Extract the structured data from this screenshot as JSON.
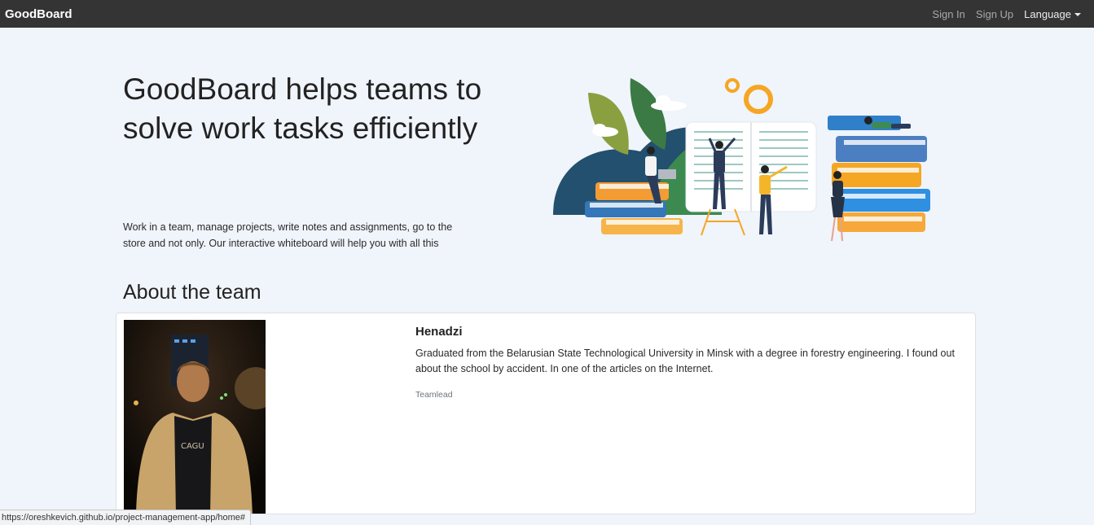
{
  "navbar": {
    "brand": "GoodBoard",
    "sign_in": "Sign In",
    "sign_up": "Sign Up",
    "language": "Language"
  },
  "hero": {
    "title": "GoodBoard helps teams to solve work tasks efficiently",
    "text": "Work in a team, manage projects, write notes and assignments, go to the store and not only. Our interactive whiteboard will help you with all this"
  },
  "about": {
    "title": "About the team",
    "members": [
      {
        "name": "Henadzi",
        "bio": "Graduated from the Belarusian State Technological University in Minsk with a degree in forestry engineering. I found out about the school by accident. In one of the articles on the Internet.",
        "role": "Teamlead"
      }
    ]
  },
  "status_bar": {
    "url": "https://oreshkevich.github.io/project-management-app/home#"
  },
  "colors": {
    "navbar_bg": "#343434",
    "page_bg": "#f0f4fb",
    "accent_blue": "#2f80c8",
    "accent_orange": "#f5a623",
    "accent_green": "#3e8a55"
  },
  "icons": {
    "language_caret": "chevron-down-icon",
    "illustration": "team-books-illustration"
  }
}
